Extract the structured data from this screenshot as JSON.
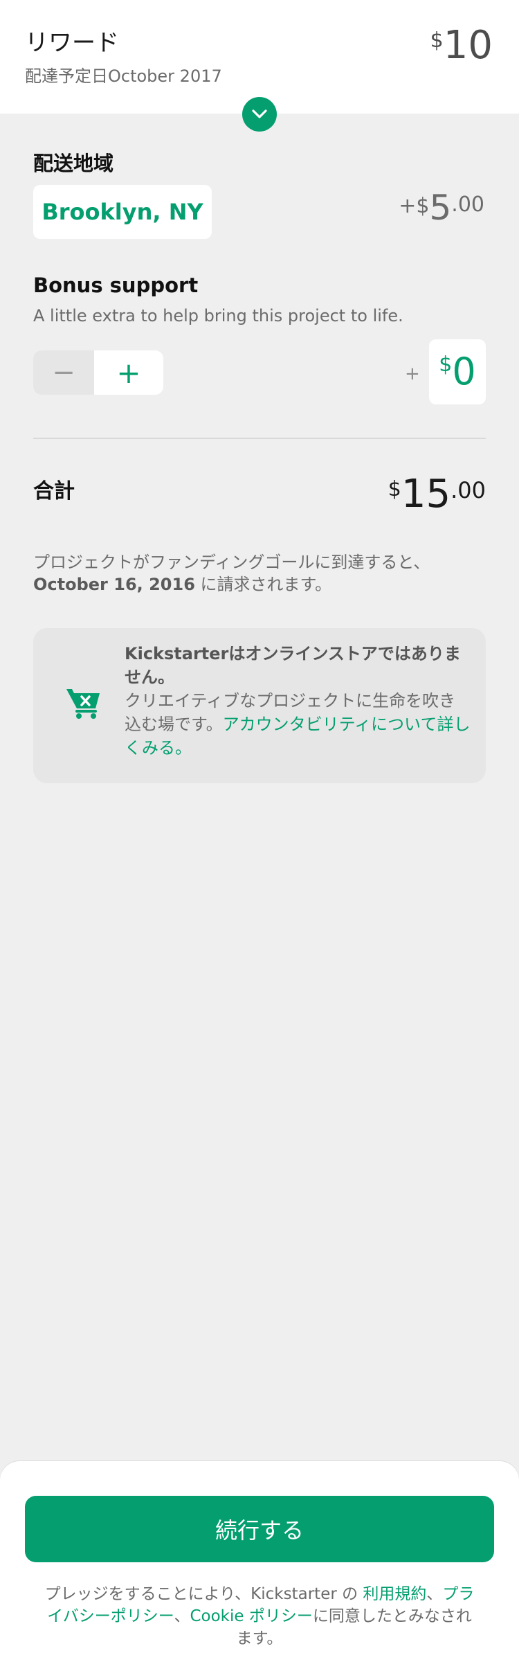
{
  "reward": {
    "title": "リワード",
    "delivery": "配達予定日October 2017",
    "price_currency": "$",
    "price_amount": "10"
  },
  "shipping": {
    "label": "配送地域",
    "location": "Brooklyn, NY",
    "cost_prefix": "+$",
    "cost_whole": "5",
    "cost_decimal": ".00"
  },
  "bonus": {
    "title": "Bonus support",
    "description": "A little extra to help bring this project to life.",
    "minus_symbol": "−",
    "plus_symbol": "+",
    "plus_sign": "+",
    "currency": "$",
    "amount": "0"
  },
  "total": {
    "label": "合計",
    "currency": "$",
    "whole": "15",
    "decimal": ".00"
  },
  "charge_note": {
    "text_before": "プロジェクトがファンディングゴールに到達すると、",
    "date": "October 16, 2016",
    "text_after": " に請求されます。"
  },
  "info_card": {
    "icon": "shopping-cart-x-icon",
    "heading": "Kickstarterはオンラインストアではありません。",
    "body": "クリエイティブなプロジェクトに生命を吹き込む場です。",
    "link": "アカウンタビリティについて詳しくみる。"
  },
  "footer": {
    "continue_label": "続行する",
    "legal_prefix": "プレッジをすることにより、Kickstarter の ",
    "terms_link": "利用規約",
    "sep1": "、",
    "privacy_link": "プライバシーポリシー",
    "sep2": "、",
    "cookie_link": "Cookie ポリシー",
    "legal_suffix": "に同意したとみなされます。"
  },
  "colors": {
    "accent": "#049e6f",
    "background": "#efefef",
    "card": "#e6e6e6"
  }
}
